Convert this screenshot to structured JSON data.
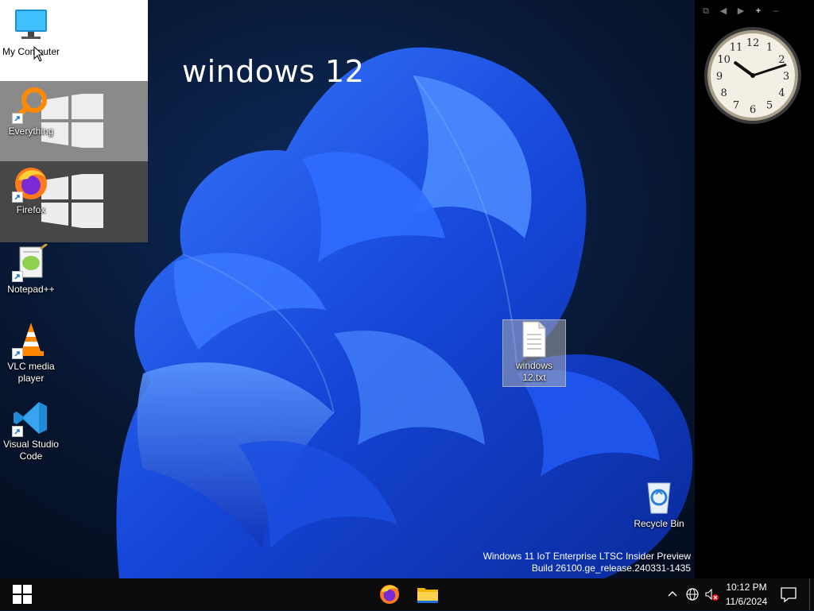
{
  "desktop": {
    "headline": "windows 12",
    "icons": [
      {
        "label": "My Computer",
        "icon": "monitor-icon"
      },
      {
        "label": "Everything",
        "icon": "everything-search-icon"
      },
      {
        "label": "Firefox",
        "icon": "firefox-icon"
      },
      {
        "label": "Notepad++",
        "icon": "notepad-plus-plus-icon"
      },
      {
        "label": "VLC media player",
        "icon": "vlc-cone-icon"
      },
      {
        "label": "Visual Studio Code",
        "icon": "vscode-icon"
      },
      {
        "label": "windows 12.txt",
        "icon": "text-file-icon"
      },
      {
        "label": "Recycle Bin",
        "icon": "recycle-bin-icon"
      }
    ],
    "build_line1": "Windows 11 IoT Enterprise LTSC Insider Preview",
    "build_line2": "Build 26100.ge_release.240331-1435"
  },
  "gadgets": {
    "toolbar": [
      "restore-icon",
      "prev-icon",
      "next-icon",
      "add-icon",
      "minimize-icon"
    ],
    "clock": {
      "hour": 10,
      "minute": 12
    }
  },
  "taskbar": {
    "start_icon": "windows-logo-icon",
    "pinned": [
      "firefox-icon",
      "file-explorer-icon"
    ],
    "tray": [
      "chevron-up-icon",
      "network-globe-icon",
      "speaker-muted-icon"
    ],
    "time": "10:12 PM",
    "date": "11/6/2024",
    "notification_icon": "action-center-icon"
  },
  "colors": {
    "taskbar": "#0c0c0c",
    "bloom_blue": "#1f5bff",
    "desktop_bg": "#07152e"
  }
}
